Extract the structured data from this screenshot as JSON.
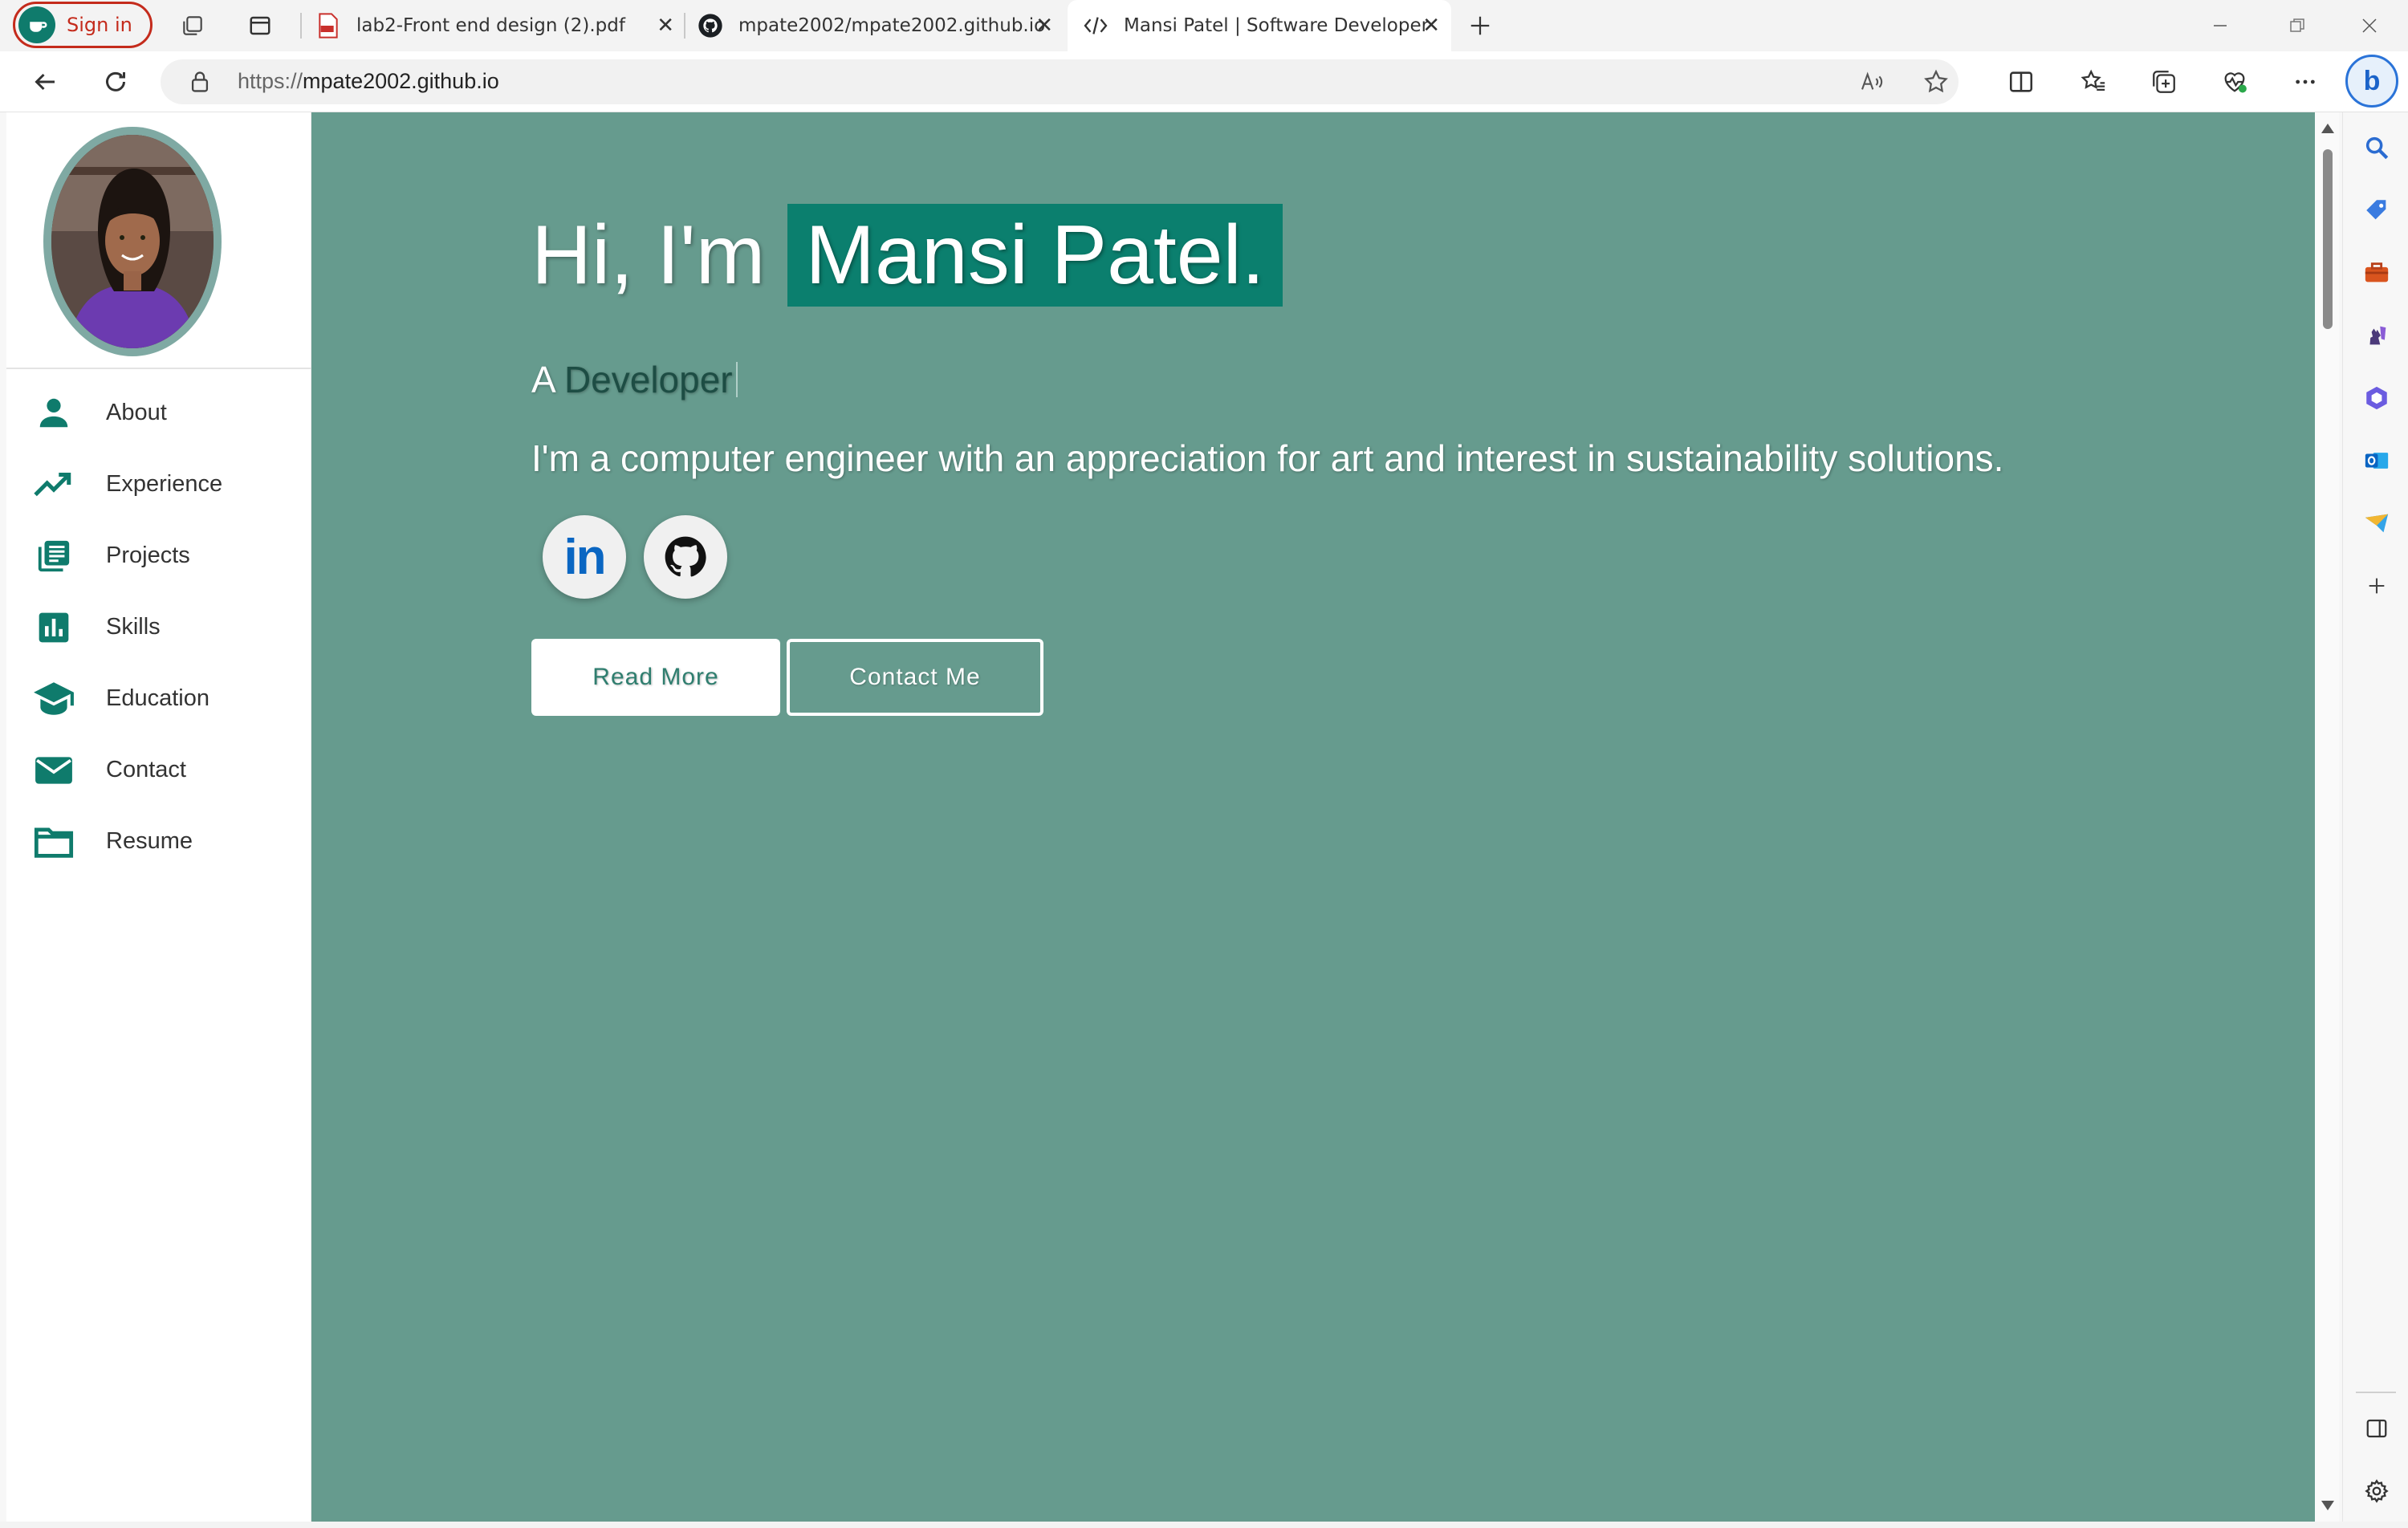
{
  "browser": {
    "signin_label": "Sign in",
    "tabs": [
      {
        "title": "lab2-Front end design (2).pdf",
        "icon": "pdf-icon"
      },
      {
        "title": "mpate2002/mpate2002.github.io",
        "icon": "github-icon"
      },
      {
        "title": "Mansi Patel | Software Developer",
        "icon": "code-icon"
      }
    ],
    "url_protocol": "https://",
    "url_host": "mpate2002.github.io"
  },
  "site": {
    "nav": [
      {
        "label": "About",
        "icon": "person-icon"
      },
      {
        "label": "Experience",
        "icon": "trending-up-icon"
      },
      {
        "label": "Projects",
        "icon": "library-books-icon"
      },
      {
        "label": "Skills",
        "icon": "bar-chart-icon"
      },
      {
        "label": "Education",
        "icon": "graduation-cap-icon"
      },
      {
        "label": "Contact",
        "icon": "mail-icon"
      },
      {
        "label": "Resume",
        "icon": "folder-icon"
      }
    ],
    "hero": {
      "greeting": "Hi, I'm",
      "name": "Mansi Patel.",
      "role_prefix": "A",
      "role_word": "Developer",
      "description": "I'm a computer engineer with an appreciation for art and interest in sustainability solutions.",
      "social": [
        {
          "label": "in",
          "icon": "linkedin-icon"
        },
        {
          "icon": "github-icon"
        }
      ],
      "read_more": "Read More",
      "contact_me": "Contact Me"
    }
  },
  "colors": {
    "accent": "#0b7f6e",
    "hero_bg": "#669b8e",
    "nav_icon": "#0f7b6c",
    "signin": "#c42b1c"
  }
}
